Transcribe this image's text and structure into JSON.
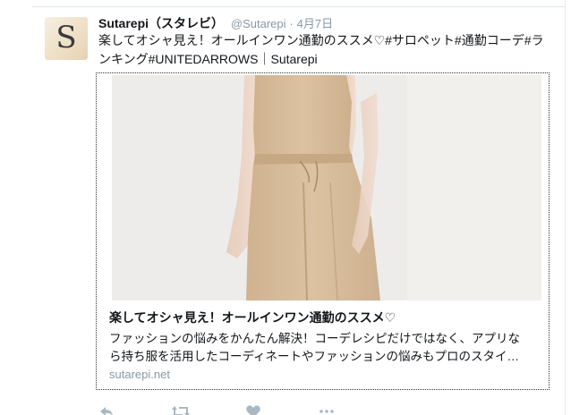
{
  "tweet": {
    "display_name": "Sutarepi（スタレビ）",
    "handle": "@Sutarepi",
    "separator": "·",
    "date": "4月7日",
    "avatar_letter": "S",
    "text_line1": "楽してオシャ見え！オールインワン通勤のススメ♡#サロペット#通勤コーデ#ラ",
    "text_line2": "ンキング#UNITEDARROWS｜Sutarepi"
  },
  "card": {
    "title": "楽してオシャ見え！オールインワン通勤のススメ♡",
    "description_line1": "ファッションの悩みをかんたん解決！コーデレシピだけではなく、アプリな",
    "description_line2": "ら持ち服を活用したコーディネートやファッションの悩みもプロのスタイ…",
    "domain": "sutarepi.net",
    "image_alt": "beige jumpsuit photo"
  },
  "actions": [
    {
      "icon": "reply-icon"
    },
    {
      "icon": "retweet-icon"
    },
    {
      "icon": "like-icon"
    },
    {
      "icon": "more-icon"
    }
  ],
  "colors": {
    "text": "#14171a",
    "muted": "#8899a6",
    "border": "#e1e8ed",
    "garment": "#d9bfa0"
  }
}
